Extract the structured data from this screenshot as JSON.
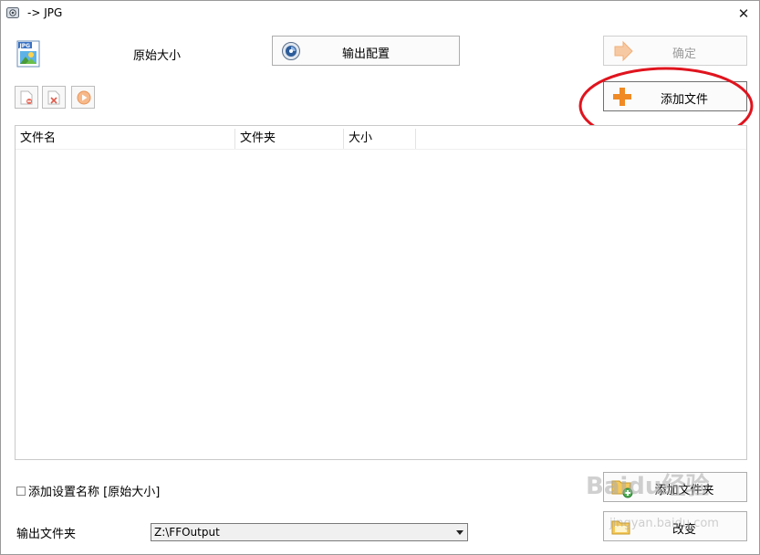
{
  "window": {
    "title": "-> JPG",
    "close_glyph": "✕"
  },
  "preset": {
    "label": "原始大小"
  },
  "buttons": {
    "output_config": "输出配置",
    "ok": "确定",
    "add_file": "添加文件",
    "add_folder": "添加文件夹",
    "change": "改变"
  },
  "toolbar": {
    "items": [
      {
        "name": "remove-item-icon"
      },
      {
        "name": "clear-list-icon"
      },
      {
        "name": "play-icon"
      }
    ]
  },
  "file_list": {
    "columns": [
      "文件名",
      "文件夹",
      "大小"
    ],
    "rows": []
  },
  "options": {
    "add_setting_name_label": "添加设置名称 [原始大小]",
    "add_setting_name_checked": false
  },
  "output_folder": {
    "label": "输出文件夹",
    "value": "Z:\\FFOutput"
  },
  "watermark": {
    "main": "Baidu经验",
    "sub": "jingyan.baidu.com"
  },
  "colors": {
    "annotation_red": "#e0141e",
    "accent_orange": "#f08a24",
    "disabled_text": "#9c9c9c"
  }
}
